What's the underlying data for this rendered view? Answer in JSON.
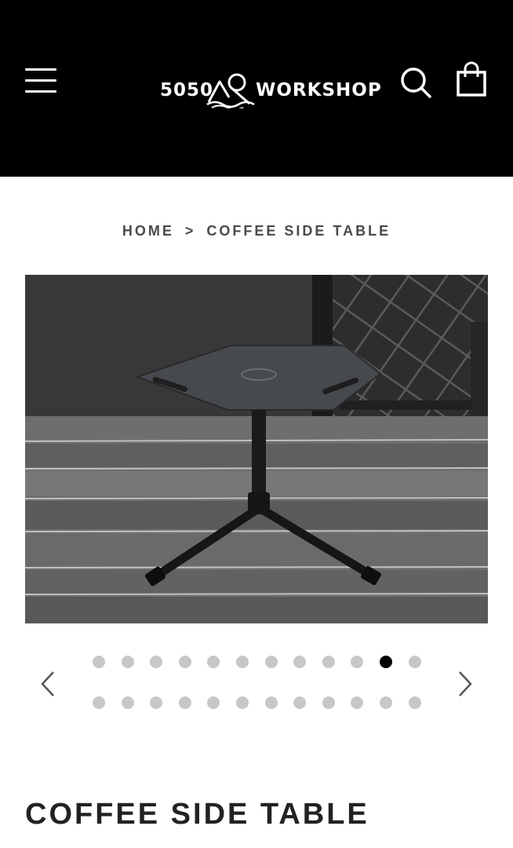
{
  "header": {
    "logo": {
      "left": "5050",
      "right": "WORKSHOP"
    },
    "menu_icon": "hamburger-menu-icon",
    "search_icon": "search-icon",
    "cart_icon": "shopping-bag-icon"
  },
  "breadcrumb": {
    "home": "HOME",
    "separator": ">",
    "current": "COFFEE SIDE TABLE"
  },
  "gallery": {
    "prev_icon": "chevron-left-icon",
    "next_icon": "chevron-right-icon",
    "total_images": 24,
    "active_index": 10
  },
  "product": {
    "title": "COFFEE SIDE TABLE"
  },
  "colors": {
    "header_bg": "#000000",
    "dot_inactive": "#c7c7c7",
    "dot_active": "#000000"
  }
}
